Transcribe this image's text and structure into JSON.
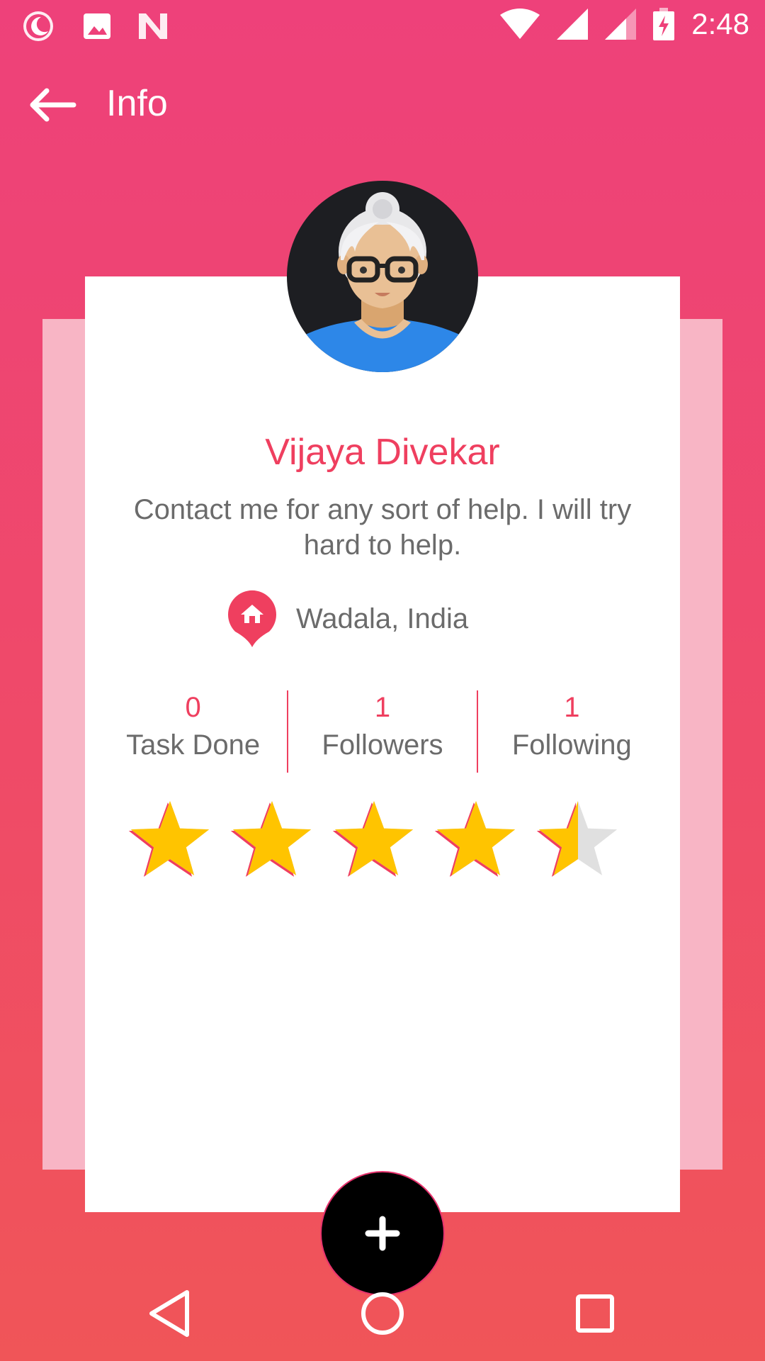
{
  "status_bar": {
    "time": "2:48",
    "icons": [
      "night-mode-icon",
      "image-icon",
      "n-logo-icon",
      "wifi-icon",
      "signal-icon",
      "signal-icon",
      "battery-charging-icon"
    ]
  },
  "app_bar": {
    "title": "Info",
    "back_icon": "arrow-back-icon"
  },
  "profile": {
    "name": "Vijaya Divekar",
    "bio": "Contact me for any sort of help. I will try hard to help.",
    "location": "Wadala, India",
    "location_icon": "home-pin-icon",
    "stats": [
      {
        "count": "0",
        "label": "Task Done"
      },
      {
        "count": "1",
        "label": "Followers"
      },
      {
        "count": "1",
        "label": "Following"
      }
    ],
    "rating": {
      "value": 4.5,
      "max": 5
    }
  },
  "fab": {
    "icon": "plus-icon"
  },
  "nav_bar": {
    "icons": [
      "back-triangle-icon",
      "home-circle-icon",
      "recents-square-icon"
    ]
  },
  "colors": {
    "accent": "#ef3f5f",
    "star": "#ffc400",
    "star_empty": "#e0e0e0",
    "text_secondary": "#6b6b6b"
  }
}
